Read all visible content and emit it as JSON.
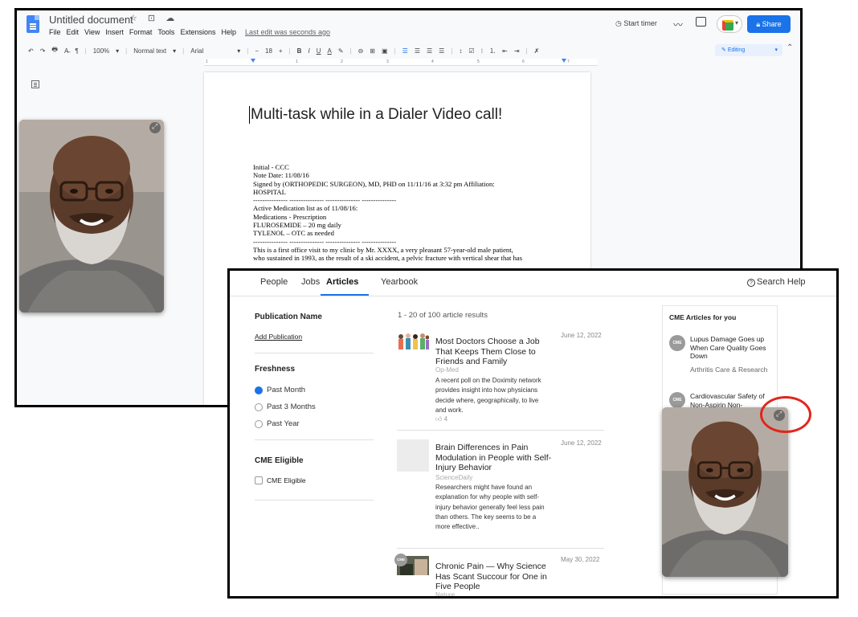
{
  "gdocs": {
    "title": "Untitled document",
    "title_icons": "☆ ⊡ ☁",
    "menu": [
      "File",
      "Edit",
      "View",
      "Insert",
      "Format",
      "Tools",
      "Extensions",
      "Help"
    ],
    "last_edit": "Last edit was seconds ago",
    "start_timer": "Start timer",
    "share_label": "Share",
    "toolbar": {
      "undo": "↶",
      "redo": "↷",
      "print": "🖶",
      "spell": "A̶",
      "paint": "¶",
      "zoom": "100%",
      "style": "Normal text",
      "font": "Arial",
      "minus": "−",
      "size": "18",
      "plus": "+",
      "bold": "B",
      "italic": "I",
      "underline": "U",
      "color": "A",
      "highlight": "✎",
      "link": "⊖",
      "comment": "⊞",
      "image": "▣"
    },
    "editing_label": "Editing",
    "ruler_numbers": [
      "1",
      "1",
      "2",
      "3",
      "4",
      "5",
      "6",
      "7"
    ],
    "document": {
      "heading": "Multi-task while in a Dialer Video call!",
      "body": "Initial - CCC\nNote Date: 11/08/16\nSigned by (ORTHOPEDIC SURGEON), MD, PHD on 11/11/16 at 3:32 pm Affiliation:\nHOSPITAL\n--------------- --------------- --------------- ---------------\nActive Medication list as of 11/08/16:\nMedications - Prescription\nFLUROSEMIDE – 20 mg daily\nTYLENOL – OTC as needed\n--------------- --------------- --------------- ---------------\nThis is a first office visit to my clinic by Mr. XXXX, a very pleasant 57-year-old male patient,\nwho sustained in 1993, as the result of a ski accident, a pelvic fracture with vertical shear that has"
    }
  },
  "doximity": {
    "nav": [
      "People",
      "Jobs",
      "Articles",
      "Yearbook"
    ],
    "active_tab": "Articles",
    "search_help": "Search Help",
    "filters": {
      "publication_name": "Publication Name",
      "add_publication": "Add Publication",
      "freshness": "Freshness",
      "freshness_options": [
        "Past Month",
        "Past 3 Months",
        "Past Year"
      ],
      "selected_freshness": "Past Month",
      "cme_eligible_heading": "CME Eligible",
      "cme_eligible_checkbox": "CME Eligible"
    },
    "results_count": "1 - 20 of 100 article results",
    "articles": [
      {
        "title": "Most Doctors Choose a Job That Keeps Them Close to Friends and Family",
        "source": "Op-Med",
        "date": "June 12, 2022",
        "description": "A recent poll on the Doximity network provides insight into how physicians decide where, geographically, to live and work.",
        "likes": "4"
      },
      {
        "title": "Brain Differences in Pain Modulation in People with Self-Injury Behavior",
        "source": "ScienceDaily",
        "date": "June 12, 2022",
        "description": "Researchers might have found an explanation for why people with self-injury behavior generally feel less pain than others. The key seems to be a more effective.."
      },
      {
        "title": "Chronic Pain — Why Science Has Scant Succour for One in Five People",
        "source": "Nature",
        "date": "May 30, 2022",
        "badge": "CME"
      }
    ],
    "cme_panel": {
      "heading": "CME Articles for you",
      "items": [
        {
          "badge": "CME",
          "title": "Lupus Damage Goes up When Care Quality Goes Down",
          "source": "Arthritis Care & Research"
        },
        {
          "badge": "CME",
          "title": "Cardiovascular Safety of Non-Aspirin Non-"
        }
      ]
    }
  },
  "colors": {
    "accent_blue": "#1a73e8",
    "annotation_red": "#e1261c"
  }
}
